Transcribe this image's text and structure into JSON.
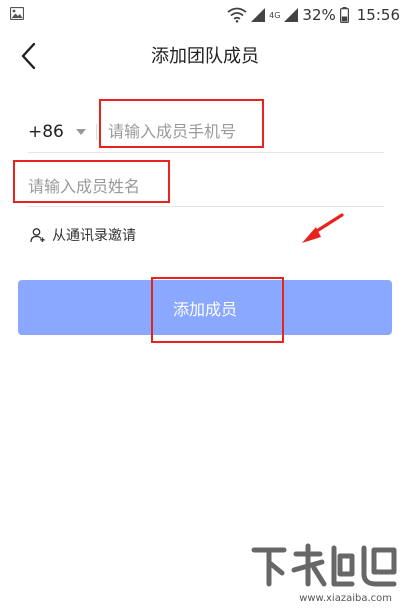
{
  "status_bar": {
    "left_icon": "gallery-icon",
    "network_label": "4G",
    "battery_percent": "32%",
    "time": "15:56"
  },
  "header": {
    "back_icon": "chevron-left-icon",
    "title": "添加团队成员"
  },
  "form": {
    "country_code": "+86",
    "phone_placeholder": "请输入成员手机号",
    "name_placeholder": "请输入成员姓名",
    "invite_link": "从通讯录邀请",
    "invite_icon": "add-contact-icon"
  },
  "actions": {
    "add_button": "添加成员"
  },
  "colors": {
    "button_bg": "#8aa8ff",
    "annotation": "#e8231e"
  },
  "watermark": {
    "url": "www.xiazaiba.com"
  }
}
